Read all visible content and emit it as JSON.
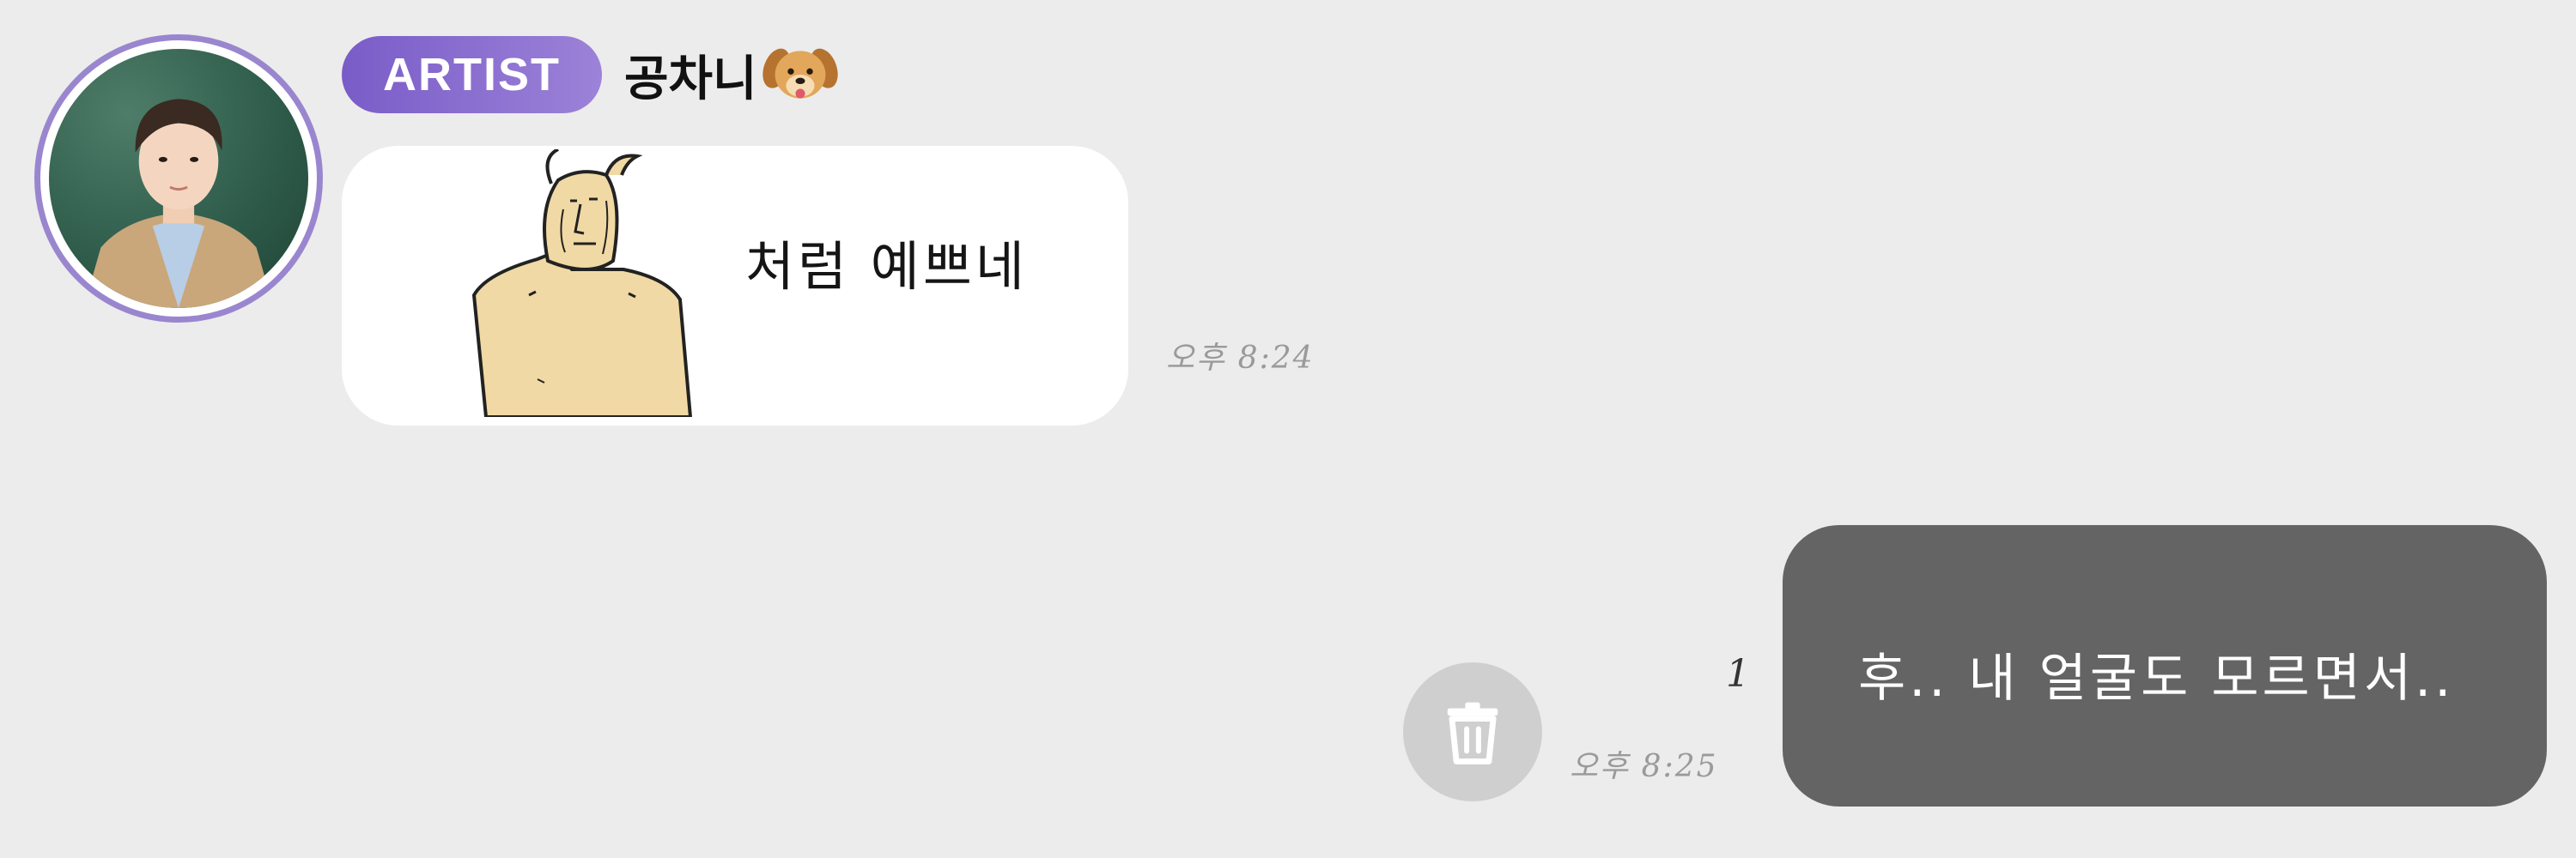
{
  "colors": {
    "background": "#ececec",
    "badge_start": "#7a5cc8",
    "badge_end": "#9c82d8",
    "avatar_ring": "#9a86cf",
    "incoming_bubble": "#ffffff",
    "outgoing_bubble": "#646464",
    "timestamp": "#9a9a9a",
    "trash_button": "#cfcfcf"
  },
  "incoming_message": {
    "sender": {
      "badge": "ARTIST",
      "name": "공차니",
      "name_emoji_icon": "dog-face-icon",
      "avatar_icon": "profile-photo"
    },
    "sticker_icon": "bald-man-sticker",
    "text": "처럼 예쁘네",
    "time": "오후 8:24"
  },
  "outgoing_message": {
    "text": "후.. 내 얼굴도 모르면서..",
    "time": "오후 8:25",
    "unread_count": "1",
    "delete_icon": "trash-icon"
  }
}
